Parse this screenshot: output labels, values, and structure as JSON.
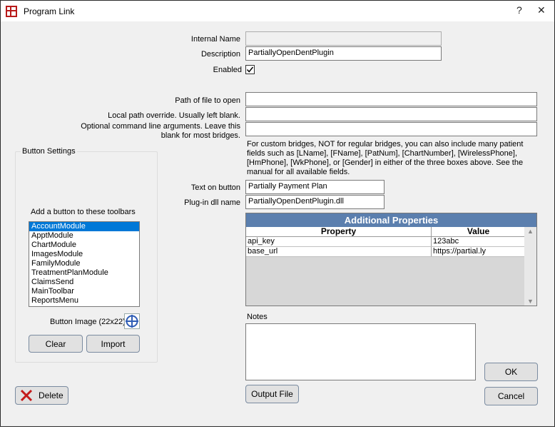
{
  "window": {
    "title": "Program Link",
    "help_label": "?",
    "close_label": "✕"
  },
  "form": {
    "internal_name_label": "Internal Name",
    "internal_name_value": "",
    "description_label": "Description",
    "description_value": "PartiallyOpenDentPlugin",
    "enabled_label": "Enabled",
    "enabled_checked": true,
    "path_label": "Path of file to open",
    "path_value": "",
    "local_path_label": "Local path override.  Usually left blank.",
    "local_path_value": "",
    "cmd_args_label": "Optional command line arguments.  Leave this blank for most bridges.",
    "cmd_args_value": "",
    "custom_note": "For custom bridges, NOT for regular bridges, you can also include many patient fields such as [LName], [FName], [PatNum], [ChartNumber], [WirelessPhone], [HmPhone], [WkPhone], or [Gender] in either of the three boxes above. See the manual for all available fields.",
    "text_on_button_label": "Text on button",
    "text_on_button_value": "Partially Payment Plan",
    "plugin_dll_label": "Plug-in dll name",
    "plugin_dll_value": "PartiallyOpenDentPlugin.dll"
  },
  "button_settings": {
    "title": "Button Settings",
    "toolbars_label": "Add a button to these toolbars",
    "toolbars": [
      "AccountModule",
      "ApptModule",
      "ChartModule",
      "ImagesModule",
      "FamilyModule",
      "TreatmentPlanModule",
      "ClaimsSend",
      "MainToolbar",
      "ReportsMenu"
    ],
    "selected_index": 0,
    "image_label": "Button Image (22x22)",
    "clear_label": "Clear",
    "import_label": "Import"
  },
  "properties": {
    "title": "Additional Properties",
    "col_property": "Property",
    "col_value": "Value",
    "rows": [
      {
        "property": "api_key",
        "value": "123abc"
      },
      {
        "property": "base_url",
        "value": "https://partial.ly"
      }
    ]
  },
  "notes": {
    "label": "Notes",
    "value": ""
  },
  "buttons": {
    "delete": "Delete",
    "output_file": "Output File",
    "ok": "OK",
    "cancel": "Cancel"
  },
  "colors": {
    "grid_title_bg": "#5b7fae",
    "list_selected_bg": "#0078d7",
    "delete_icon": "#c41a1a"
  }
}
